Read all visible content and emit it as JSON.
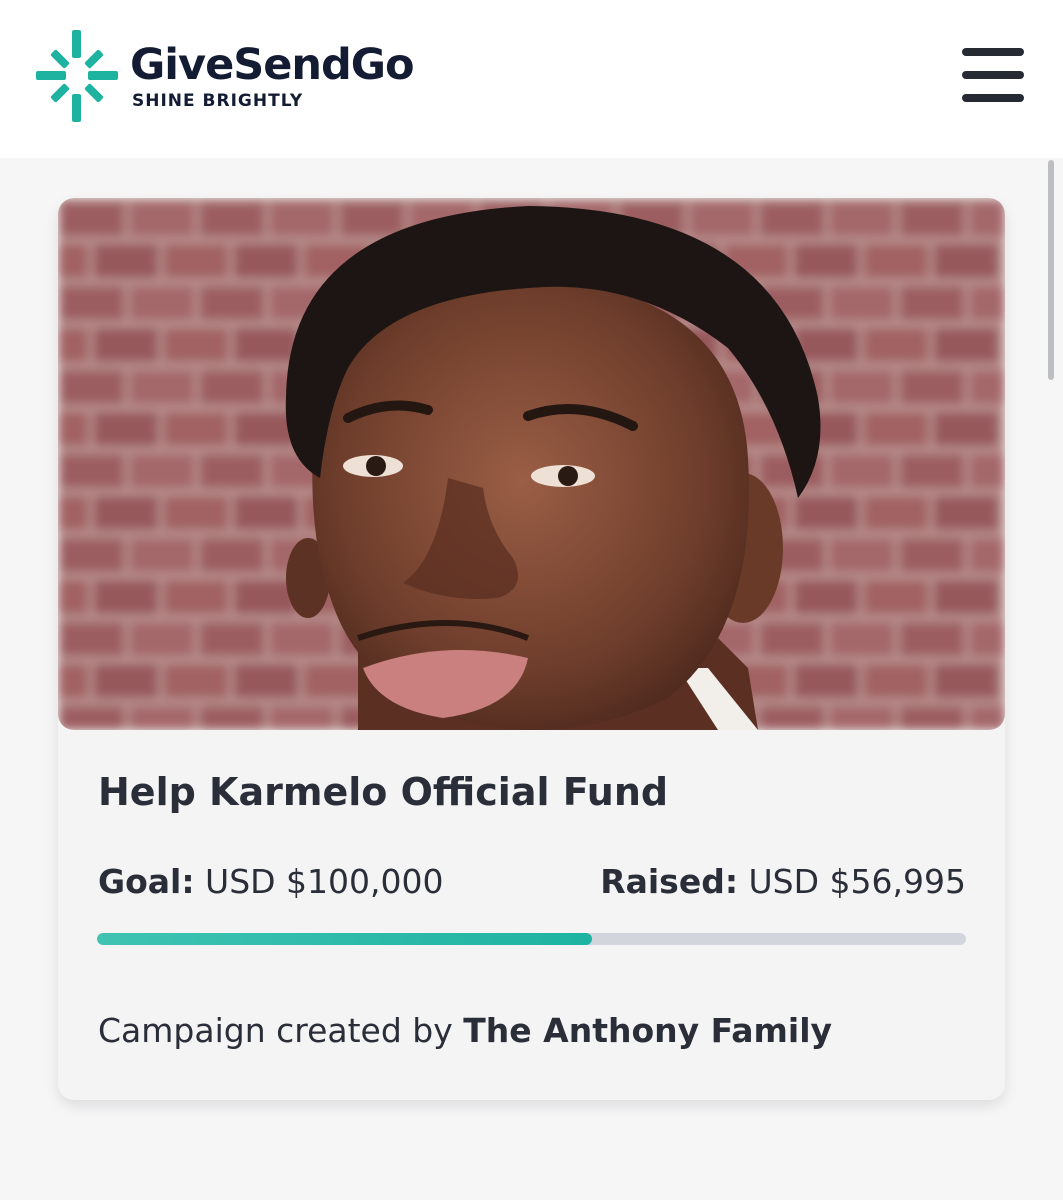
{
  "header": {
    "brand_name": "GiveSendGo",
    "tagline": "SHINE BRIGHTLY",
    "logo_icon": "sparkle-burst-icon",
    "menu_icon": "hamburger-menu-icon"
  },
  "colors": {
    "brand_teal": "#1eb3a1",
    "brand_navy": "#141c33",
    "progress_track": "#d3d5dc",
    "page_background": "#f6f6f7"
  },
  "campaign": {
    "image_description_icon": "campaign-photo",
    "title": "Help Karmelo Official Fund",
    "goal_label": "Goal:",
    "goal_value": "USD $100,000",
    "raised_label": "Raised:",
    "raised_value": "USD $56,995",
    "progress_fraction": 0.56995,
    "creator_prefix": "Campaign created by",
    "creator_name": "The Anthony Family"
  }
}
